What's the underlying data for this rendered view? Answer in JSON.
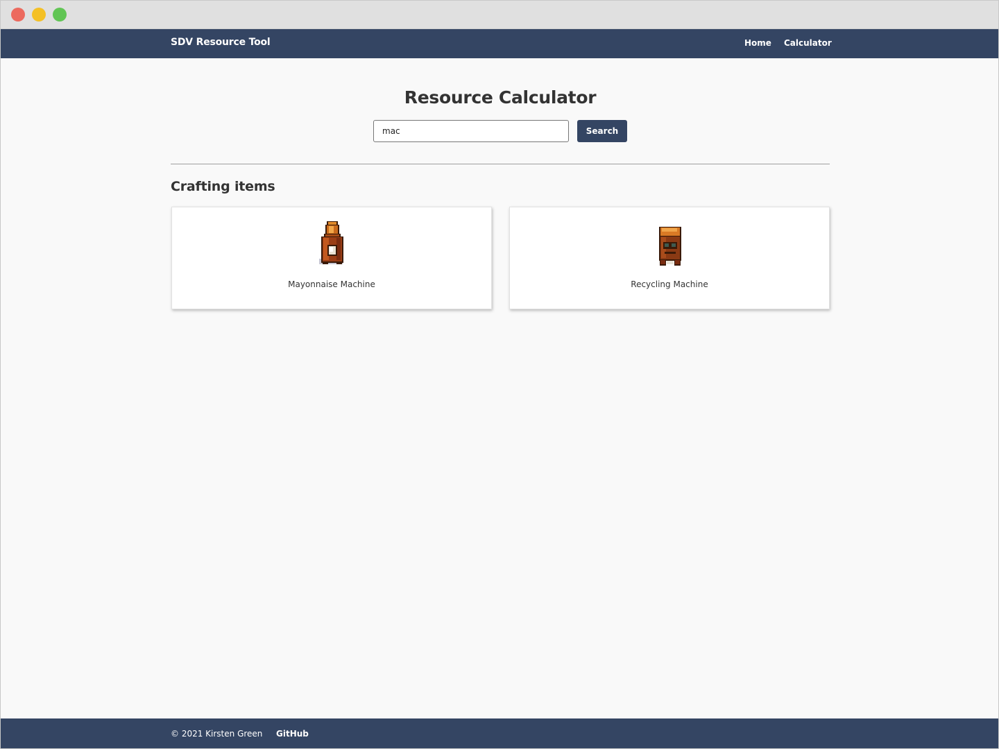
{
  "window": {
    "controls": [
      "close",
      "minimize",
      "zoom"
    ]
  },
  "navbar": {
    "brand": "SDV Resource Tool",
    "links": [
      "Home",
      "Calculator"
    ]
  },
  "main": {
    "title": "Resource Calculator",
    "search": {
      "value": "mac",
      "button_label": "Search"
    },
    "section_heading": "Crafting items",
    "items": [
      {
        "name": "Mayonnaise Machine",
        "icon": "mayonnaise-machine-icon"
      },
      {
        "name": "Recycling Machine",
        "icon": "recycling-machine-icon"
      }
    ]
  },
  "footer": {
    "copyright": "© 2021 Kirsten Green",
    "github_label": "GitHub"
  },
  "colors": {
    "primary": "#344563",
    "background": "#f9f9f9",
    "text": "#333333"
  }
}
